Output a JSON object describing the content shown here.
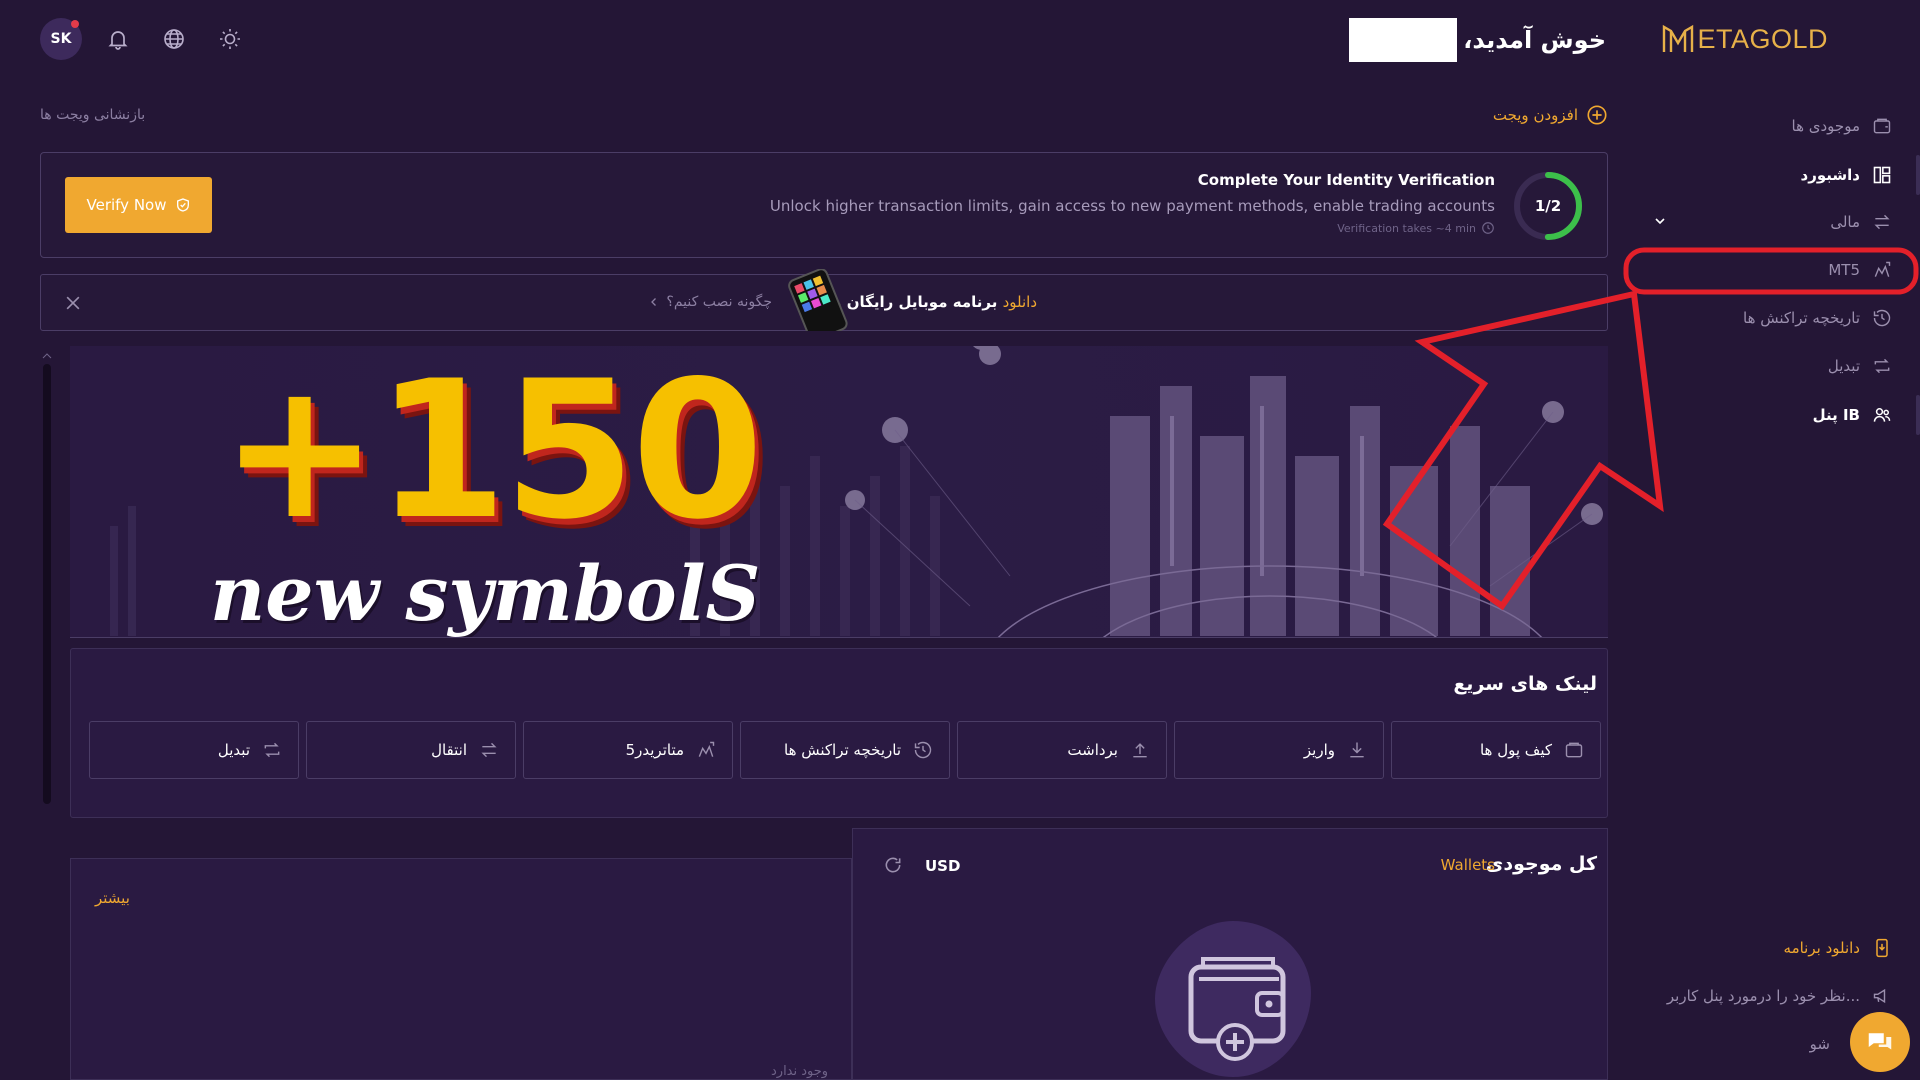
{
  "header": {
    "avatar_initials": "SK",
    "welcome_text": "خوش آمدید،",
    "logo_text": "ETAGOLD",
    "icons": [
      "bell-icon",
      "globe-icon",
      "sun-icon"
    ]
  },
  "sidebar": {
    "items": [
      {
        "label": "موجودی ها",
        "icon": "wallet-icon"
      },
      {
        "label": "داشبورد",
        "icon": "dashboard-icon"
      },
      {
        "label": "مالی",
        "icon": "transfer-icon"
      },
      {
        "label": "MT5",
        "icon": "mt5-icon"
      },
      {
        "label": "تاریخچه تراکنش ها",
        "icon": "history-icon"
      },
      {
        "label": "تبدیل",
        "icon": "convert-icon"
      },
      {
        "label": "پنل IB",
        "icon": "users-icon"
      }
    ],
    "footer": [
      {
        "label": "دانلود برنامه",
        "icon": "download-app-icon"
      },
      {
        "label": "نظر خود را درمورد پنل کاربر...",
        "icon": "megaphone-icon"
      },
      {
        "label": "شو",
        "icon": "link-icon"
      }
    ]
  },
  "widgets": {
    "add_label": "افزودن ویجت",
    "reset_label": "بازنشانی ویجت ها"
  },
  "identity": {
    "title": "Complete Your Identity Verification",
    "description": "Unlock higher transaction limits, gain access to new payment methods, enable trading accounts",
    "time_note": "Verification takes ~4 min",
    "progress_text": "1/2",
    "progress_fraction": 0.5,
    "button_label": "Verify Now"
  },
  "app_banner": {
    "download_word": "دانلود",
    "text": "برنامه موبایل رایگان ما",
    "how_label": "چگونه نصب کنیم؟"
  },
  "hero": {
    "headline": "+150",
    "subline": "new symbolS"
  },
  "quick_links": {
    "title": "لینک های سریع",
    "items": [
      {
        "label": "کیف پول ها",
        "icon": "wallet-icon"
      },
      {
        "label": "واریز",
        "icon": "deposit-icon"
      },
      {
        "label": "برداشت",
        "icon": "withdraw-icon"
      },
      {
        "label": "تاریخچه تراکنش ها",
        "icon": "history-icon"
      },
      {
        "label": "متاتریدر5",
        "icon": "mt5-icon"
      },
      {
        "label": "انتقال",
        "icon": "transfer-icon"
      },
      {
        "label": "تبدیل",
        "icon": "convert-icon"
      }
    ]
  },
  "balance": {
    "title": "کل موجودی",
    "wallets_link": "Wallets",
    "currency": "USD"
  },
  "left_panel": {
    "more_label": "بیشتر",
    "empty_note": "وجود ندارد"
  },
  "colors": {
    "background": "#241636",
    "accent": "#f0a830",
    "progress": "#3cbf4a",
    "annotation": "#e3202a"
  }
}
